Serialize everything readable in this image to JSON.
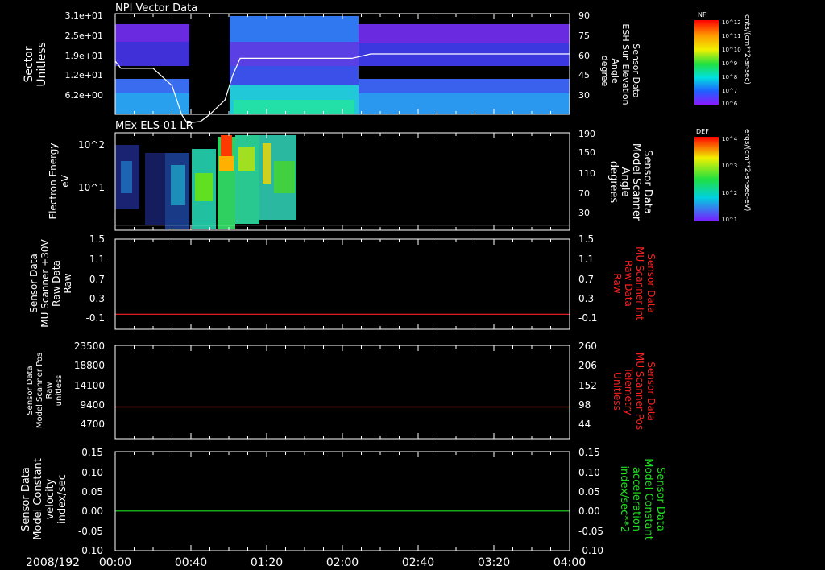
{
  "date_label": "2008/192",
  "x_tick_labels": [
    "00:00",
    "00:40",
    "01:20",
    "02:00",
    "02:40",
    "03:20",
    "04:00"
  ],
  "colors": {
    "panel_bg": "#000000",
    "axis": "#ffffff",
    "red": "#ff2020",
    "green": "#20e020"
  },
  "chart_data": [
    {
      "type": "heatmap",
      "title": "NPI Vector Data",
      "ylabel": [
        "Sector",
        "Unitless"
      ],
      "ytick_labels": [
        "3.1e+01",
        "2.5e+01",
        "1.9e+01",
        "1.2e+01",
        "6.2e+00"
      ],
      "right_ylabel": [
        "Sensor Data",
        "ESH Sun Elevation",
        "Angle",
        "degree"
      ],
      "right_ytick_labels": [
        "90",
        "75",
        "60",
        "45",
        "30"
      ],
      "colorbar": {
        "label": "NF",
        "unit": "cnts/(cm**2-sr-sec)",
        "tick_labels": [
          "10^12",
          "10^11",
          "10^10",
          "10^9",
          "10^8",
          "10^7",
          "10^6"
        ]
      },
      "overlay_line": {
        "color": "#ffffff",
        "x_minutes": [
          0,
          3,
          20,
          30,
          35,
          38,
          45,
          50,
          58,
          62,
          66,
          75,
          90,
          110,
          125,
          135,
          240
        ],
        "angle_deg": [
          57,
          52,
          52,
          40,
          20,
          14,
          15,
          20,
          30,
          47,
          59,
          59,
          59,
          59,
          59,
          62,
          62
        ]
      }
    },
    {
      "type": "heatmap",
      "title": "MEx ELS-01 LR",
      "ylabel": [
        "Electron Energy",
        "eV"
      ],
      "ytick_labels": [
        "10^2",
        "10^1"
      ],
      "right_ylabel": [
        "Sensor Data",
        "Model Scanner",
        "Angle",
        "degrees"
      ],
      "right_ytick_labels": [
        "190",
        "150",
        "110",
        "70",
        "30"
      ],
      "colorbar": {
        "label": "DEF",
        "unit": "ergs/(cm**2-sr-sec-eV)",
        "tick_labels": [
          "10^4",
          "10^3",
          "10^2",
          "10^1"
        ]
      },
      "overlay_line": {
        "color": "#ffffff",
        "x_minutes": [
          0,
          240
        ],
        "angle_deg": [
          10,
          10
        ]
      }
    },
    {
      "type": "line",
      "ylabel": [
        "Sensor Data",
        "MU Scanner +30V",
        "Raw Data",
        "Raw"
      ],
      "ytick_labels": [
        "1.5",
        "1.1",
        "0.7",
        "0.3",
        "-0.1"
      ],
      "right_ylabel": [
        "Sensor Data",
        "MU Scanner Int",
        "Raw Data",
        "Raw"
      ],
      "right_ytick_labels": [
        "1.5",
        "1.1",
        "0.7",
        "0.3",
        "-0.1"
      ],
      "ylim": [
        -0.3,
        1.5
      ],
      "series": [
        {
          "name": "Sensor Data MU Scanner Int Raw Data",
          "color": "#ff2020",
          "x_minutes": [
            0,
            240
          ],
          "values": [
            0.0,
            0.0
          ]
        }
      ]
    },
    {
      "type": "line",
      "ylabel": [
        "Sensor Data",
        "Model Scanner Pos",
        "Raw",
        "unitless"
      ],
      "ytick_labels": [
        "23500",
        "18800",
        "14100",
        "9400",
        "4700"
      ],
      "right_ylabel": [
        "Sensor Data",
        "MU Scanner Pos",
        "Telemetry",
        "Unitless"
      ],
      "right_ytick_labels": [
        "260",
        "206",
        "152",
        "98",
        "44"
      ],
      "ylim": [
        0,
        23500
      ],
      "series": [
        {
          "name": "Sensor Data MU Scanner Pos Telemetry",
          "color": "#ff2020",
          "x_minutes": [
            0,
            240
          ],
          "values": [
            8000,
            8000
          ]
        }
      ]
    },
    {
      "type": "line",
      "ylabel": [
        "Sensor Data",
        "Model Constant",
        "velocity",
        "index/sec"
      ],
      "ytick_labels": [
        "0.15",
        "0.10",
        "0.05",
        "0.00",
        "-0.05",
        "-0.10"
      ],
      "right_ylabel": [
        "Sensor Data",
        "Model Constant",
        "acceleration",
        "index/sec**2"
      ],
      "right_ytick_labels": [
        "0.15",
        "0.10",
        "0.05",
        "0.00",
        "-0.05",
        "-0.10"
      ],
      "ylim": [
        -0.1,
        0.15
      ],
      "series": [
        {
          "name": "Sensor Data Model Constant acceleration",
          "color": "#20e020",
          "x_minutes": [
            0,
            240
          ],
          "values": [
            0.0,
            0.0
          ]
        }
      ]
    }
  ]
}
